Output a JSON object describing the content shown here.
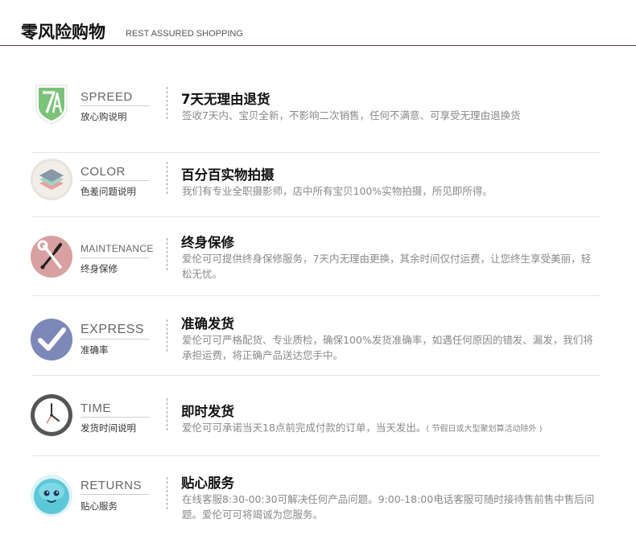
{
  "header": {
    "title": "零风险购物",
    "subtitle": "REST ASSURED SHOPPING"
  },
  "items": [
    {
      "en": "SPREED",
      "cn": "放心购说明",
      "title": "7天无理由退货",
      "desc": "签收7天内、宝贝全新，不影响二次销售，任何不满意、可享受无理由退换货",
      "icon": "shield-7-icon",
      "icon_color": "#7cc27a"
    },
    {
      "en": "COLOR",
      "cn": "色差问题说明",
      "title": "百分百实物拍摄",
      "desc": "我们有专业全职摄影师，店中所有宝贝100%实物拍摄，所见即所得。",
      "icon": "color-layers-icon",
      "icon_color": "#e8e4dc"
    },
    {
      "en": "MAINTENANCE",
      "cn": "终身保修",
      "title": "终身保修",
      "desc": "爱伦可可提供终身保修服务，7天内无理由更换，其余时间仅付运费，让您终生享受美丽，轻松无忧。",
      "icon": "tools-icon",
      "icon_color": "#d8a0a0"
    },
    {
      "en": "EXPRESS",
      "cn": "准确率",
      "title": "准确发货",
      "desc": "爱伦可可严格配货、专业质检，确保100%发货准确率，如遇任何原因的错发、漏发，我们将承担运费，将正确产品送达您手中。",
      "icon": "checkmark-icon",
      "icon_color": "#7b88b8"
    },
    {
      "en": "TIME",
      "cn": "发货时间说明",
      "title": "即时发货",
      "desc": "爱伦可可承诺当天18点前完成付款的订单，当天发出。",
      "note": "( 节假日或大型聚划算活动除外 )",
      "icon": "clock-icon",
      "icon_color": "#555555"
    },
    {
      "en": "RETURNS",
      "cn": "贴心服务",
      "title": "贴心服务",
      "desc": "在线客服8:30-00:30可解决任何产品问题。9:00-18:00电话客服可随时接待售前售中售后问题。爱伦可可将竭诚为您服务。",
      "icon": "service-mascot-icon",
      "icon_color": "#5bc8d8"
    }
  ]
}
